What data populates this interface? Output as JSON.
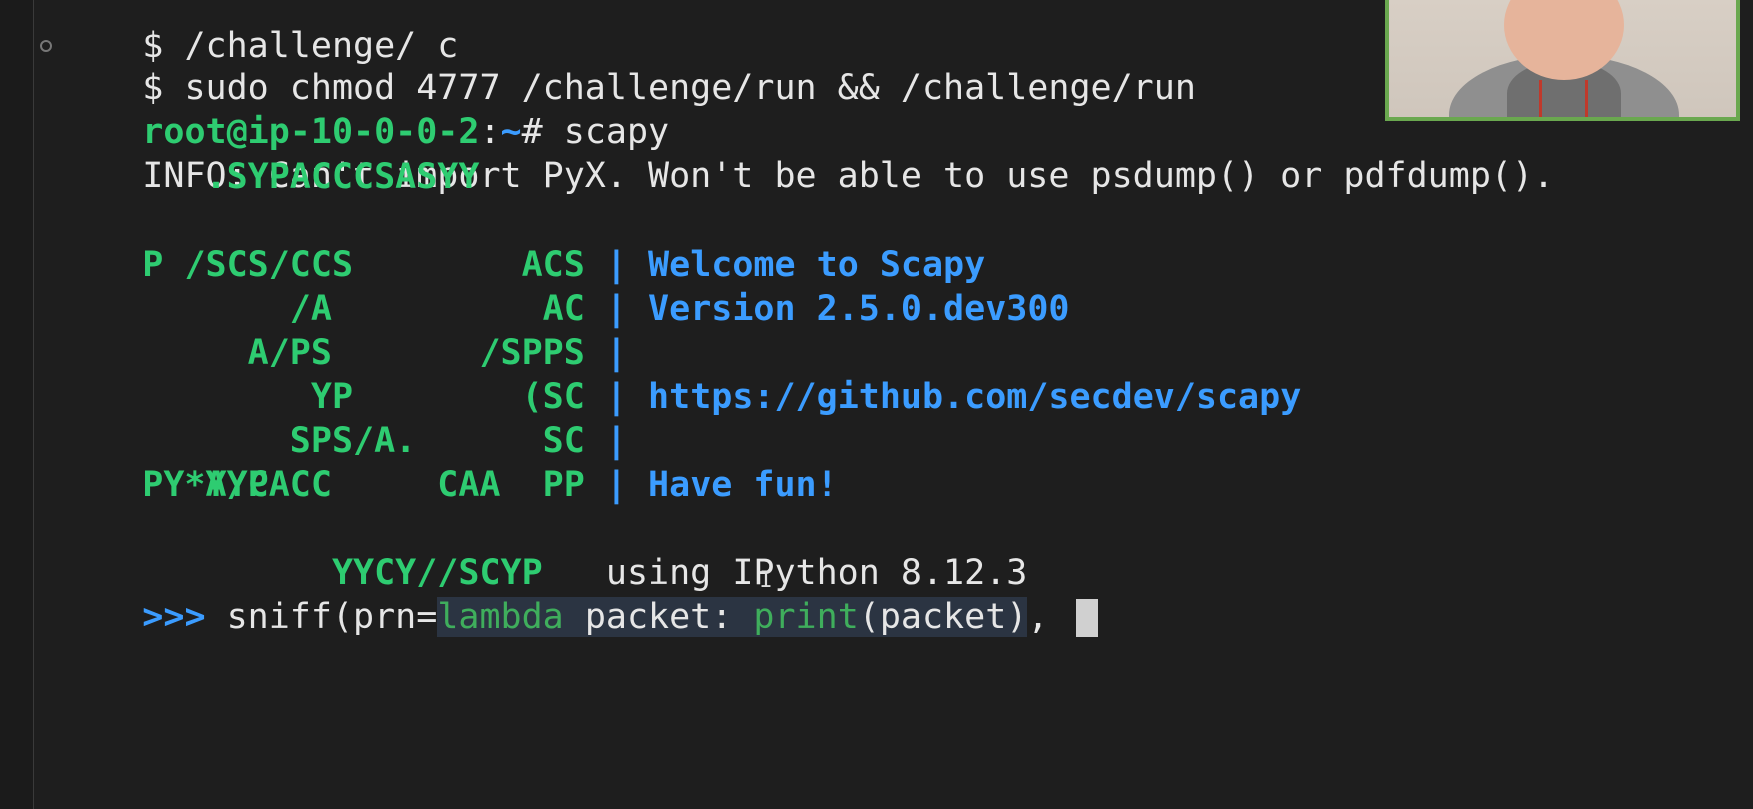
{
  "terminal": {
    "line0": "$ /challenge/ c",
    "line1": "$ sudo chmod 4777 /challenge/run && /challenge/run",
    "prompt": {
      "userhost": "root@ip-10-0-0-2",
      "colon": ":",
      "path": "~",
      "symbol": "#",
      "command": " scapy"
    },
    "info": "INFO: Can't import PyX. Won't be able to use psdump() or pdfdump().",
    "logo": [
      "       .SYPACCCSASYY",
      "P /SCS/CCS        ACS",
      "       /A          AC",
      "     A/PS       /SPPS",
      "        YP        (SC",
      "       SPS/A.      SC",
      "   Y/PACC          PP",
      "    PY*AYC        CAA",
      "         YYCY//SCYP"
    ],
    "sep": " |",
    "banner": [
      "Welcome to Scapy",
      "Version 2.5.0.dev300",
      "",
      "https://github.com/secdev/scapy",
      "",
      "Have fun!"
    ],
    "ipython": "using IPython 8.12.3",
    "repl": {
      "prompt": ">>>",
      "before": " sniff(prn=",
      "kw_lambda": "lambda",
      "mid1": " packet: ",
      "kw_print": "print",
      "mid2": "(packet)",
      "after": ", "
    }
  }
}
